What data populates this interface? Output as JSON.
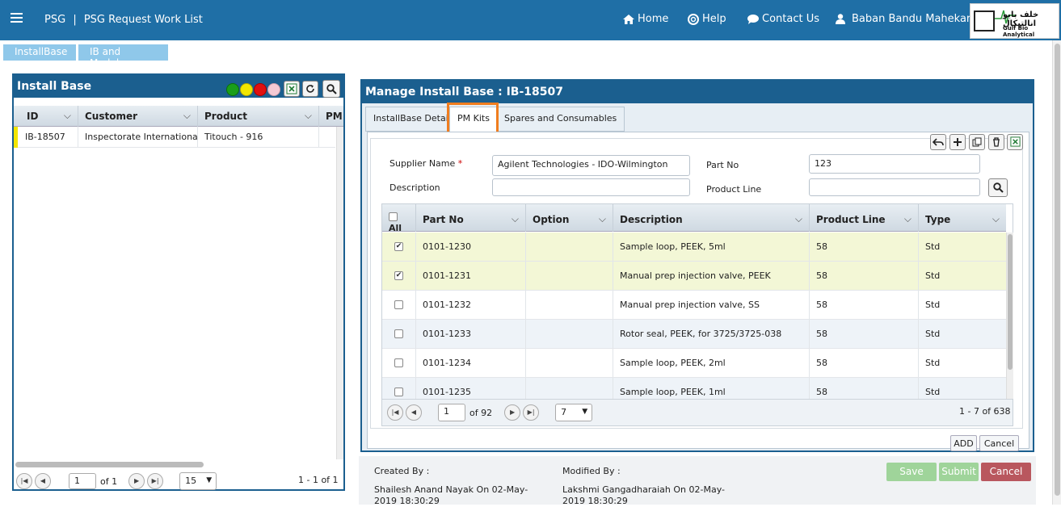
{
  "header": {
    "brand": "PSG",
    "page_title": "PSG Request Work List",
    "nav": {
      "home": "Home",
      "help": "Help",
      "contact": "Contact Us",
      "user": "Baban Bandu Mahekar"
    },
    "logo": {
      "arabic": "خلف بايو انالتيكال",
      "english": "Gulf Bio Analytical"
    }
  },
  "crumbs": [
    "InstallBase",
    "IB and Module"
  ],
  "left_panel": {
    "title": "Install Base",
    "status_colors": [
      "#1a9e1a",
      "#f2e600",
      "#e01010",
      "#f3c9d4"
    ],
    "columns": [
      "ID",
      "Customer",
      "Product",
      "PM"
    ],
    "rows": [
      {
        "id": "IB-18507",
        "customer": "Inspectorate International ...",
        "product": "Titouch - 916"
      }
    ],
    "pager": {
      "page": "1",
      "of": "of 1",
      "size": "15",
      "summary": "1 - 1 of 1"
    }
  },
  "manage": {
    "title": "Manage Install Base : IB-18507",
    "tabs": [
      "InstallBase Details",
      "PM Kits",
      "Spares and Consumables"
    ],
    "active_tab": "PM Kits",
    "highlight_color": "#f07d1f",
    "form": {
      "supplier_label": "Supplier Name",
      "supplier_value": "Agilent Technologies - IDO-Wilmington",
      "description_label": "Description",
      "description_value": "",
      "partno_label": "Part No",
      "partno_value": "123",
      "productline_label": "Product Line",
      "productline_value": ""
    },
    "grid": {
      "all_label": "All",
      "columns": [
        "Part No",
        "Option",
        "Description",
        "Product Line",
        "Type"
      ],
      "rows": [
        {
          "checked": true,
          "part": "0101-1230",
          "option": "",
          "desc": "Sample loop, PEEK, 5ml",
          "line": "58",
          "type": "Std"
        },
        {
          "checked": true,
          "part": "0101-1231",
          "option": "",
          "desc": "Manual prep injection valve, PEEK",
          "line": "58",
          "type": "Std"
        },
        {
          "checked": false,
          "part": "0101-1232",
          "option": "",
          "desc": "Manual prep injection valve, SS",
          "line": "58",
          "type": "Std"
        },
        {
          "checked": false,
          "part": "0101-1233",
          "option": "",
          "desc": "Rotor seal, PEEK, for 3725/3725-038",
          "line": "58",
          "type": "Std"
        },
        {
          "checked": false,
          "part": "0101-1234",
          "option": "",
          "desc": "Sample loop, PEEK, 2ml",
          "line": "58",
          "type": "Std"
        },
        {
          "checked": false,
          "part": "0101-1235",
          "option": "",
          "desc": "Sample loop, PEEK, 1ml",
          "line": "58",
          "type": "Std"
        }
      ],
      "pager": {
        "page": "1",
        "of": "of 92",
        "size": "7",
        "summary": "1 - 7 of 638"
      }
    },
    "buttons": {
      "add": "ADD",
      "cancel": "Cancel"
    }
  },
  "footer": {
    "created_label": "Created By :",
    "created_value": "Shailesh Anand Nayak On 02-May-2019 18:30:29",
    "modified_label": "Modified By :",
    "modified_value": "Lakshmi Gangadharaiah On 02-May-2019 18:30:29",
    "save": "Save",
    "submit": "Submit",
    "cancel": "Cancel"
  }
}
